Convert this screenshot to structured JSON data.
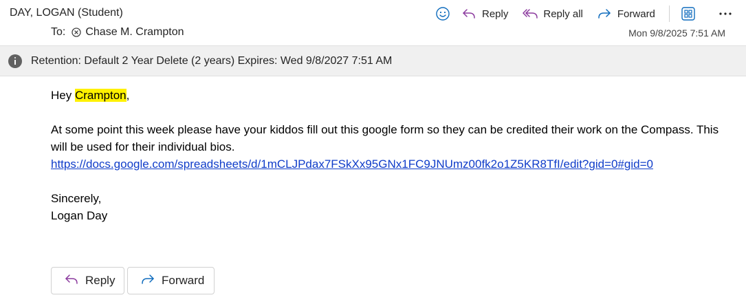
{
  "header": {
    "sender": "DAY, LOGAN (Student)",
    "to_label": "To:",
    "recipient": "Chase M. Crampton",
    "date": "Mon 9/8/2025 7:51 AM"
  },
  "actions": {
    "reply": "Reply",
    "reply_all": "Reply all",
    "forward": "Forward"
  },
  "retention": {
    "text": "Retention: Default 2 Year Delete (2 years) Expires: Wed 9/8/2027 7:51 AM"
  },
  "message": {
    "greeting_prefix": "Hey ",
    "greeting_name": "Crampton",
    "greeting_suffix": ",",
    "paragraph": "At some point this week please have your kiddos fill out this google form so they can be credited their work on the Compass. This will be used for their individual bios.",
    "link": "https://docs.google.com/spreadsheets/d/1mCLJPdax7FSkXx95GNx1FC9JNUmz00fk2o1Z5KR8TfI/edit?gid=0#gid=0",
    "signoff": "Sincerely,",
    "signature": "Logan Day"
  },
  "bottom_actions": {
    "reply": "Reply",
    "forward": "Forward"
  },
  "colors": {
    "accent_blue": "#0f6cbd",
    "reply_purple": "#8b3a9e",
    "highlight": "#fff100",
    "link": "#0f3cc9"
  },
  "icons": {
    "emoji": "emoji-icon",
    "reply": "reply-icon",
    "reply_all": "reply-all-icon",
    "forward": "forward-icon",
    "immersive": "immersive-reader-icon",
    "more": "more-icon",
    "info": "info-icon",
    "remove": "remove-recipient-icon"
  }
}
